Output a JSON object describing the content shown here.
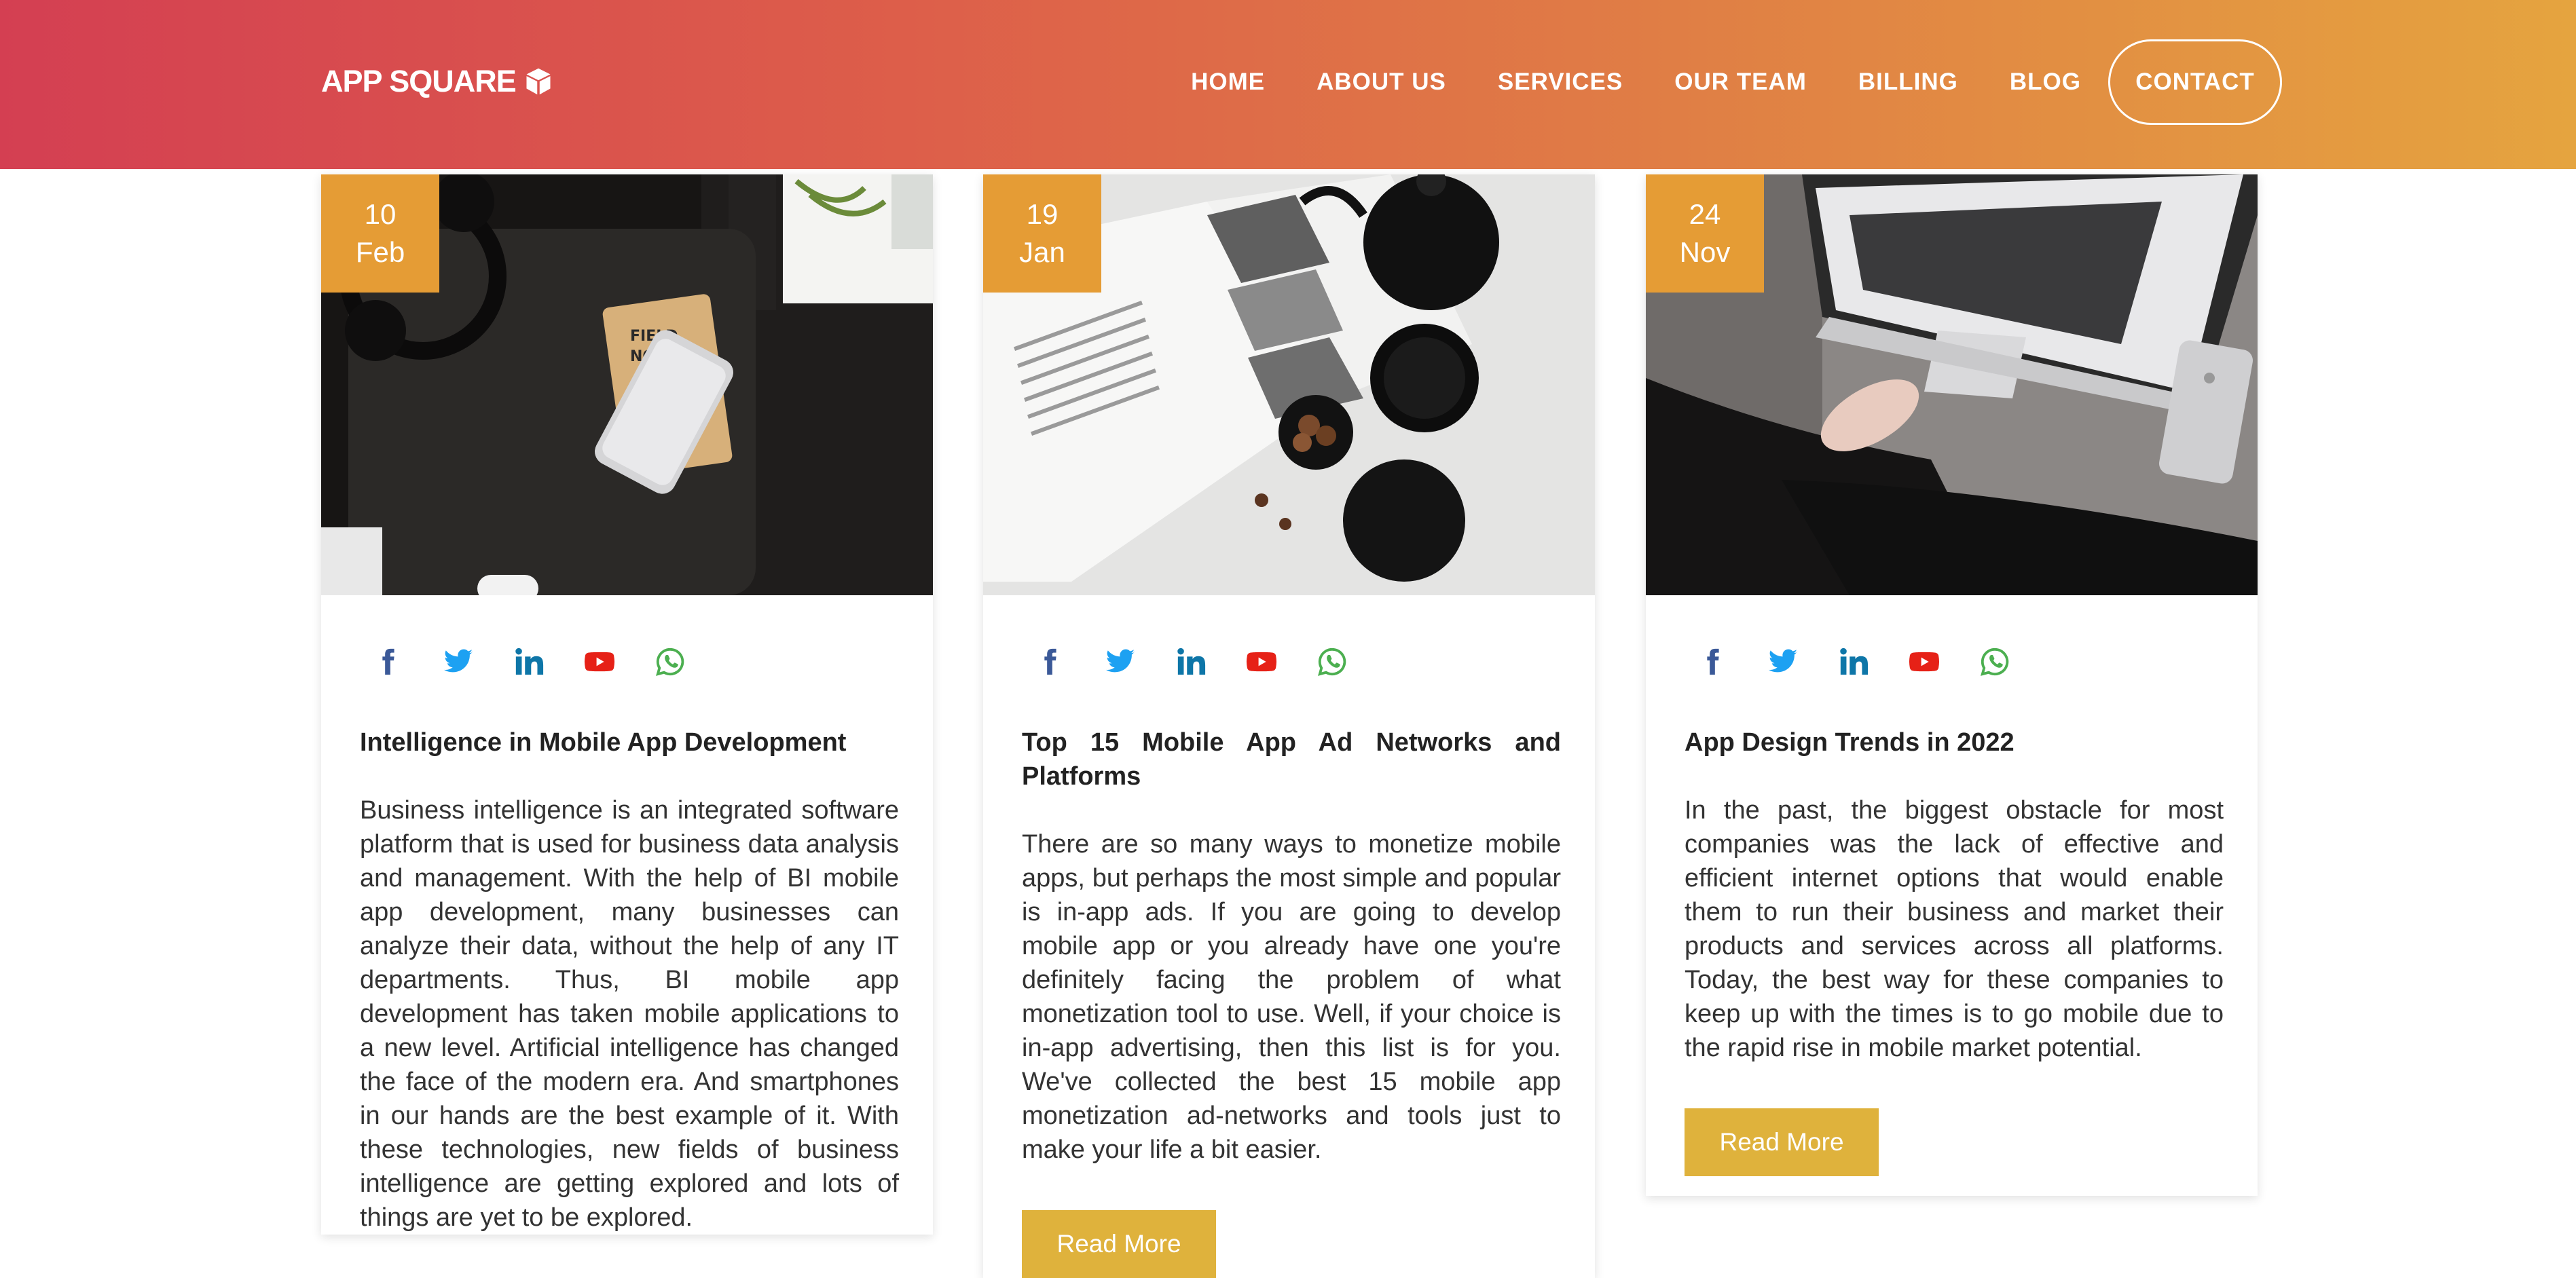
{
  "header": {
    "logo_text": "APP SQUARE",
    "logo_icon": "cube-icon",
    "nav": [
      "HOME",
      "ABOUT US",
      "SERVICES",
      "OUR TEAM",
      "BILLING",
      "BLOG"
    ],
    "contact_label": "CONTACT"
  },
  "colors": {
    "header_gradient_start": "#d43f52",
    "header_gradient_end": "#e5a43f",
    "date_badge": "#e59c35",
    "read_more": "#dfb23c",
    "facebook": "#3b5998",
    "twitter": "#1da1f2",
    "linkedin": "#0e76a8",
    "youtube": "#e62117",
    "whatsapp": "#4caf50"
  },
  "social_icons": [
    "facebook-icon",
    "twitter-icon",
    "linkedin-icon",
    "youtube-icon",
    "whatsapp-icon"
  ],
  "cards": [
    {
      "day": "10",
      "month": "Feb",
      "image": "desk-headphones-phone-notebook",
      "title": "Intelligence in Mobile App Development",
      "text": "Business intelligence is an integrated software platform that is used for business data analysis and management. With the help of BI mobile app development, many businesses can analyze their data, without the help of any IT departments. Thus, BI mobile app development has taken mobile applications to a new level. Artificial intelligence has changed the face of the modern era. And smartphones in our hands are the best example of it. With these technologies, new fields of business intelligence are getting explored and lots of things are yet to be explored.",
      "button": "Read More"
    },
    {
      "day": "19",
      "month": "Jan",
      "image": "open-magazine-teapot-bowls",
      "title": "Top 15 Mobile App Ad Networks and Platforms",
      "text": "There are so many ways to monetize mobile apps, but perhaps the most simple and popular is in-app ads. If you are going to develop mobile app or you already have one you're definitely facing the problem of what monetization tool to use. Well, if your choice is in-app advertising, then this list is for you. We've collected the best 15 mobile app monetization ad-networks and tools just to make your life a bit easier.",
      "button": "Read More"
    },
    {
      "day": "24",
      "month": "Nov",
      "image": "laptop-on-fur-rug",
      "title": "App Design Trends in 2022",
      "text": "In the past, the biggest obstacle for most companies was the lack of effective and efficient internet options that would enable them to run their business and market their products and services across all platforms. Today, the best way for these companies to keep up with the times is to go mobile due to the rapid rise in mobile market potential.",
      "button": "Read More"
    }
  ]
}
